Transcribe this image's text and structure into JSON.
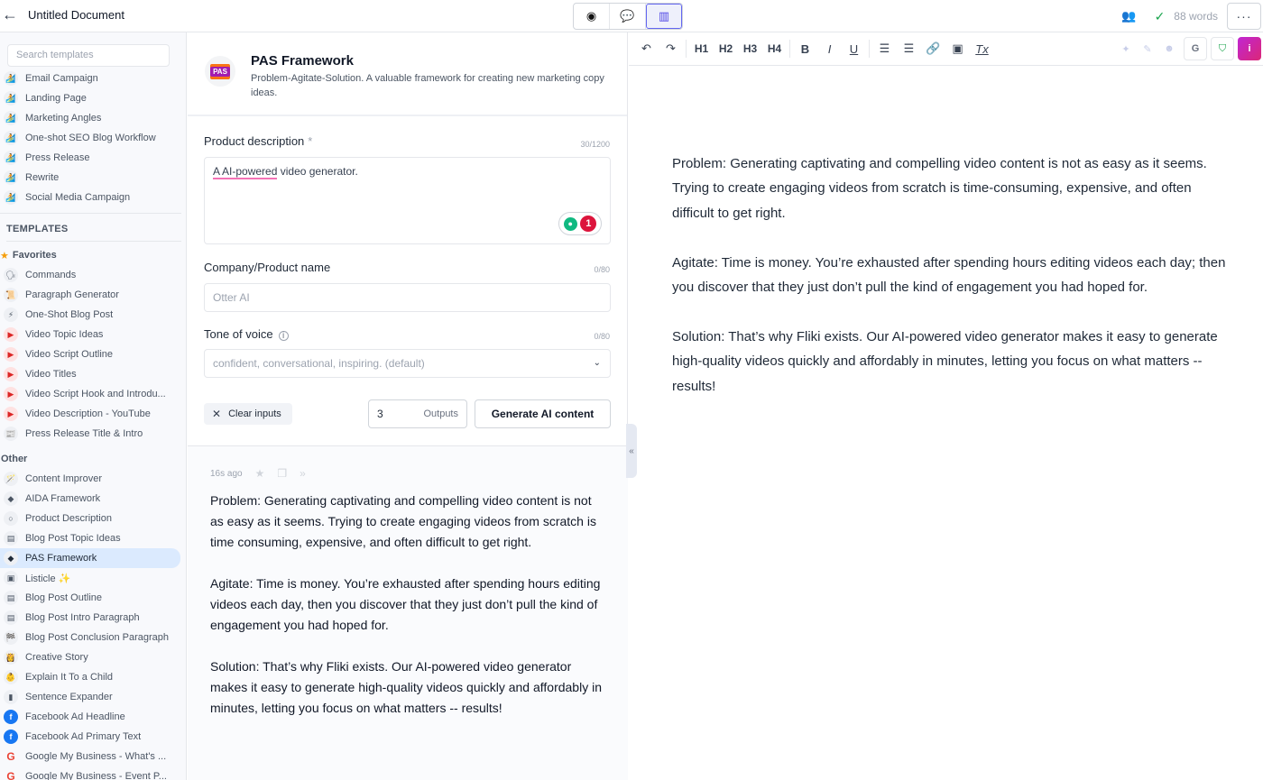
{
  "topbar": {
    "back_icon": "arrow-left-icon",
    "title": "Untitled Document",
    "view_modes": [
      {
        "name": "preview",
        "icon": "eye-icon",
        "glyph": "◉"
      },
      {
        "name": "chat",
        "icon": "chat-icon",
        "glyph": "💬"
      },
      {
        "name": "split",
        "icon": "panel-icon",
        "glyph": "▥",
        "active": true
      }
    ],
    "users_glyph": "👥",
    "check_glyph": "✓",
    "word_count": "88 words",
    "more_glyph": "···"
  },
  "sidebar": {
    "search_placeholder": "Search templates",
    "workflow_items": [
      {
        "label": "Email Campaign",
        "glyph": "🏄"
      },
      {
        "label": "Landing Page",
        "glyph": "🏄"
      },
      {
        "label": "Marketing Angles",
        "glyph": "🏄"
      },
      {
        "label": "One-shot SEO Blog Workflow",
        "glyph": "🏄"
      },
      {
        "label": "Press Release",
        "glyph": "🏄"
      },
      {
        "label": "Rewrite",
        "glyph": "🏄"
      },
      {
        "label": "Social Media Campaign",
        "glyph": "🏄"
      }
    ],
    "templates_heading": "TEMPLATES",
    "favorites_heading": "Favorites",
    "favorites_glyph": "★",
    "favorites": [
      {
        "label": "Commands",
        "glyph": "🗣",
        "kind": "plain"
      },
      {
        "label": "Paragraph Generator",
        "glyph": "📜",
        "kind": "plain"
      },
      {
        "label": "One-Shot Blog Post",
        "glyph": "⚡",
        "kind": "plain"
      },
      {
        "label": "Video Topic Ideas",
        "glyph": "▶",
        "kind": "yt"
      },
      {
        "label": "Video Script Outline",
        "glyph": "▶",
        "kind": "yt"
      },
      {
        "label": "Video Titles",
        "glyph": "▶",
        "kind": "yt"
      },
      {
        "label": "Video Script Hook and Introdu...",
        "glyph": "▶",
        "kind": "yt"
      },
      {
        "label": "Video Description - YouTube",
        "glyph": "▶",
        "kind": "yt"
      },
      {
        "label": "Press Release Title & Intro",
        "glyph": "📰",
        "kind": "plain"
      }
    ],
    "other_heading": "Other",
    "other": [
      {
        "label": "Content Improver",
        "glyph": "🪄",
        "kind": "plain"
      },
      {
        "label": "AIDA Framework",
        "glyph": "◆",
        "kind": "plain"
      },
      {
        "label": "Product Description",
        "glyph": "○",
        "kind": "plain"
      },
      {
        "label": "Blog Post Topic Ideas",
        "glyph": "▤",
        "kind": "plain"
      },
      {
        "label": "PAS Framework",
        "glyph": "◆",
        "kind": "plain",
        "active": true
      },
      {
        "label": "Listicle ✨",
        "glyph": "▣",
        "kind": "plain"
      },
      {
        "label": "Blog Post Outline",
        "glyph": "▤",
        "kind": "plain"
      },
      {
        "label": "Blog Post Intro Paragraph",
        "glyph": "▤",
        "kind": "plain"
      },
      {
        "label": "Blog Post Conclusion Paragraph",
        "glyph": "🏁",
        "kind": "plain"
      },
      {
        "label": "Creative Story",
        "glyph": "👸",
        "kind": "plain"
      },
      {
        "label": "Explain It To a Child",
        "glyph": "👶",
        "kind": "plain"
      },
      {
        "label": "Sentence Expander",
        "glyph": "▮",
        "kind": "plain"
      },
      {
        "label": "Facebook Ad Headline",
        "glyph": "f",
        "kind": "fb"
      },
      {
        "label": "Facebook Ad Primary Text",
        "glyph": "f",
        "kind": "fb"
      },
      {
        "label": "Google My Business - What's ...",
        "glyph": "G",
        "kind": "g"
      },
      {
        "label": "Google My Business - Event P...",
        "glyph": "G",
        "kind": "g"
      }
    ]
  },
  "form": {
    "logo_text": "PAS",
    "title": "PAS Framework",
    "description": "Problem-Agitate-Solution. A valuable framework for creating new marketing copy ideas.",
    "product_description": {
      "label": "Product description",
      "required_mark": "*",
      "counter": "30/1200",
      "value_misspelled": "A AI-powered",
      "value_rest": " video generator.",
      "suggestion_count": "1"
    },
    "company_name": {
      "label": "Company/Product name",
      "counter": "0/80",
      "placeholder": "Otter AI"
    },
    "tone": {
      "label": "Tone of voice",
      "counter": "0/80",
      "placeholder": "confident, conversational, inspiring. (default)"
    },
    "clear_label": "Clear inputs",
    "outputs_value": "3",
    "outputs_label": "Outputs",
    "generate_label": "Generate AI content"
  },
  "result": {
    "timestamp": "16s ago",
    "paragraphs": [
      "Problem: Generating captivating and compelling video content is not as easy as it seems. Trying to create engaging videos from scratch is time consuming, expensive, and often difficult to get right.",
      "Agitate: Time is money. You’re exhausted after spending hours editing videos each day, then you discover that they just don’t pull the kind of engagement you had hoped for.",
      "Solution: That’s why Fliki exists. Our AI-powered video generator makes it easy to generate high-quality videos quickly and affordably in minutes, letting you focus on what matters -- results!"
    ]
  },
  "collapse_glyph": "«",
  "editor": {
    "toolbar": {
      "undo": "↶",
      "redo": "↷",
      "h1": "H1",
      "h2": "H2",
      "h3": "H3",
      "h4": "H4",
      "bold": "B",
      "italic": "I",
      "underline": "U",
      "ordered_list": "☰",
      "bullet_list": "☰",
      "link": "🔗",
      "image": "▣",
      "clear_format": "Tx",
      "sparkle": "✦",
      "pen": "✎",
      "emoji": "☻",
      "grammarly": "G",
      "shield": "⛉",
      "info": "i"
    },
    "paragraphs": [
      "Problem: Generating captivating and compelling video content is not as easy as it seems. Trying to create engaging videos from scratch is time-consuming, expensive, and often difficult to get right.",
      "Agitate: Time is money. You’re exhausted after spending hours editing videos each day; then you discover that they just don’t pull the kind of engagement you had hoped for.",
      "Solution: That’s why Fliki exists. Our AI-powered video generator makes it easy to generate high-quality videos quickly and affordably in minutes, letting you focus on what matters -- results!"
    ]
  }
}
